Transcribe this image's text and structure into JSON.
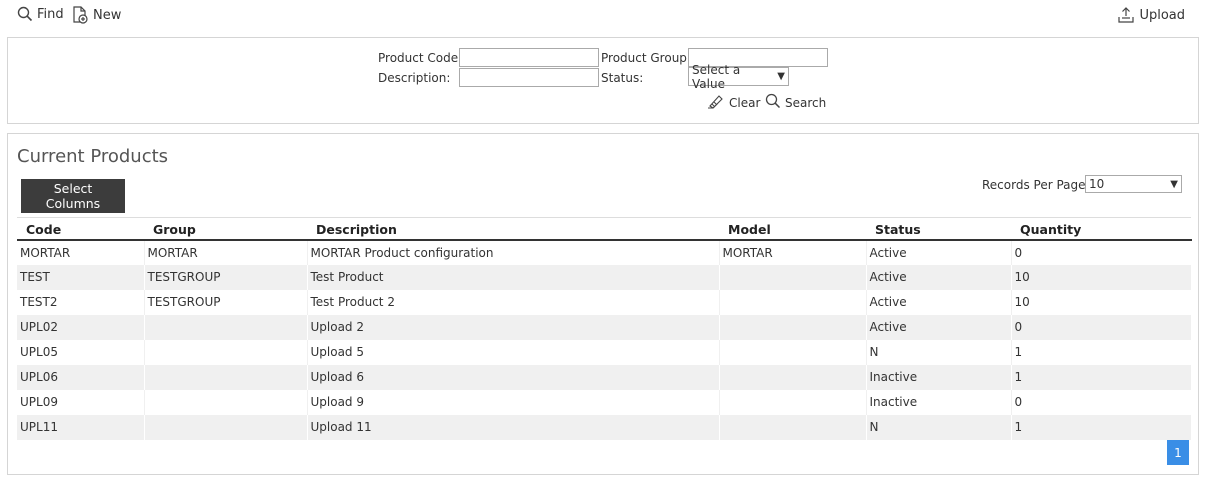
{
  "toolbar": {
    "find_label": "Find",
    "find_icon": "search-icon",
    "new_label": "New",
    "new_icon": "new-document-icon",
    "upload_label": "Upload",
    "upload_icon": "upload-icon"
  },
  "filters": {
    "product_code_label": "Product Code:",
    "product_code_value": "",
    "product_group_label": "Product Group:",
    "product_group_value": "",
    "description_label": "Description:",
    "description_value": "",
    "status_label": "Status:",
    "status_selected": "Select a Value",
    "clear_label": "Clear",
    "clear_icon": "eraser-icon",
    "search_label": "Search",
    "search_icon": "search-icon"
  },
  "products": {
    "title": "Current Products",
    "select_columns_label": "Select Columns",
    "records_per_page_label": "Records Per Page:",
    "records_per_page_value": "10",
    "columns": [
      "Code",
      "Group",
      "Description",
      "Model",
      "Status",
      "Quantity"
    ],
    "rows": [
      {
        "code": "MORTAR",
        "group": "MORTAR",
        "description": "MORTAR Product configuration",
        "model": "MORTAR",
        "status": "Active",
        "quantity": "0"
      },
      {
        "code": "TEST",
        "group": "TESTGROUP",
        "description": "Test Product",
        "model": "",
        "status": "Active",
        "quantity": "10"
      },
      {
        "code": "TEST2",
        "group": "TESTGROUP",
        "description": "Test Product 2",
        "model": "",
        "status": "Active",
        "quantity": "10"
      },
      {
        "code": "UPL02",
        "group": "",
        "description": "Upload 2",
        "model": "",
        "status": "Active",
        "quantity": "0"
      },
      {
        "code": "UPL05",
        "group": "",
        "description": "Upload 5",
        "model": "",
        "status": "N",
        "quantity": "1"
      },
      {
        "code": "UPL06",
        "group": "",
        "description": "Upload 6",
        "model": "",
        "status": "Inactive",
        "quantity": "1"
      },
      {
        "code": "UPL09",
        "group": "",
        "description": "Upload 9",
        "model": "",
        "status": "Inactive",
        "quantity": "0"
      },
      {
        "code": "UPL11",
        "group": "",
        "description": "Upload 11",
        "model": "",
        "status": "N",
        "quantity": "1"
      }
    ],
    "pagination": {
      "current_page": "1"
    }
  },
  "colors": {
    "button_dark": "#3c3c3c",
    "pager_blue": "#3a8ee6",
    "row_alt": "#f0f0f0",
    "border": "#d5d5d5"
  }
}
